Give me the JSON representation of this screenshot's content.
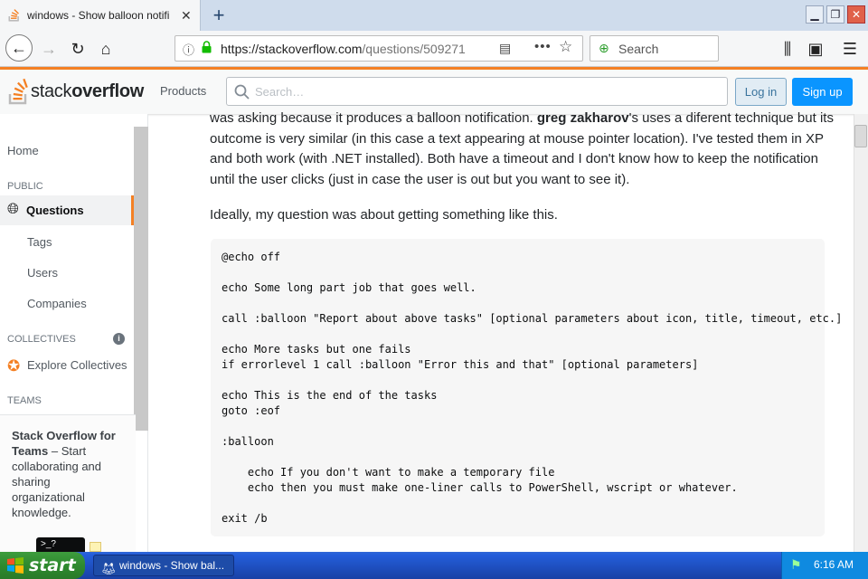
{
  "browser": {
    "tab_title": "windows - Show balloon notifi",
    "url_host": "https://stackoverflow.com",
    "url_path": "/questions/509271",
    "search_placeholder": "Search"
  },
  "so_header": {
    "logo_text_regular": "stack",
    "logo_text_bold": "overflow",
    "products_label": "Products",
    "search_placeholder": "Search…",
    "login_label": "Log in",
    "signup_label": "Sign up"
  },
  "left_nav": {
    "home": "Home",
    "public_heading": "PUBLIC",
    "questions": "Questions",
    "tags": "Tags",
    "users": "Users",
    "companies": "Companies",
    "collectives_heading": "COLLECTIVES",
    "explore_collectives": "Explore Collectives",
    "teams_heading": "TEAMS",
    "teams_title": "Stack Overflow for Teams",
    "teams_desc": "– Start collaborating and sharing organizational knowledge."
  },
  "content": {
    "para1_part1": "was asking because it produces a balloon notification. ",
    "para1_bold": "greg zakharov",
    "para1_part2": "'s uses a diferent technique but its outcome is very similar (in this case a text appearing at mouse pointer location). I've tested them in XP and both work (with .NET installed). Both have a timeout and I don't know how to keep the notification until the user clicks (just in case the user is out but you want to see it).",
    "para2": "Ideally, my question was about getting something like this.",
    "code": "@echo off\n\necho Some long part job that goes well.\n\ncall :balloon \"Report about above tasks\" [optional parameters about icon, title, timeout, etc.]\n\necho More tasks but one fails\nif errorlevel 1 call :balloon \"Error this and that\" [optional parameters]\n\necho This is the end of the tasks\ngoto :eof\n\n:balloon\n\n    echo If you don't want to make a temporary file\n    echo then you must make one-liner calls to PowerShell, wscript or whatever.\n\nexit /b"
  },
  "taskbar": {
    "start_label": "start",
    "task_label": "windows - Show bal...",
    "clock": "6:16 AM",
    "cmd_icon_text": ">_?"
  }
}
